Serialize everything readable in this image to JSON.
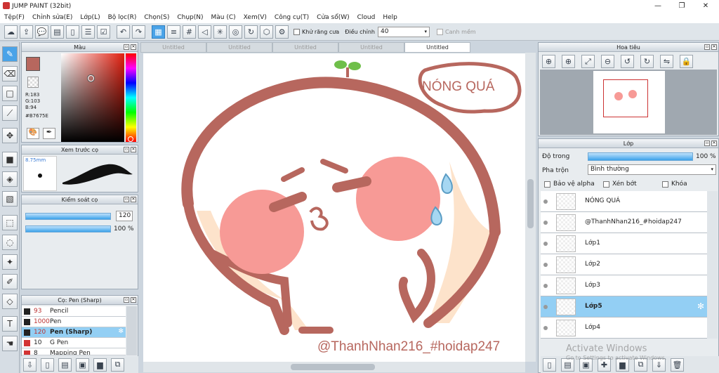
{
  "window": {
    "title": "JUMP PAINT (32bit)",
    "min": "—",
    "max": "❐",
    "close": "✕"
  },
  "menu": [
    "Tệp(F)",
    "Chỉnh sửa(E)",
    "Lớp(L)",
    "Bộ lọc(R)",
    "Chọn(S)",
    "Chụp(N)",
    "Màu (C)",
    "Xem(V)",
    "Công cụ(T)",
    "Cửa sổ(W)",
    "Cloud",
    "Help"
  ],
  "toolbar": {
    "antialias_label": "Khử răng cưa",
    "adjust_label": "Điều chỉnh",
    "adjust_value": "40",
    "edge_label": "Canh mềm"
  },
  "color_panel": {
    "title": "Màu",
    "r": "R:183",
    "g": "G:103",
    "b": "B:94",
    "hex": "#B7675E",
    "main_color": "#B7675E"
  },
  "preview_panel": {
    "title": "Xem trước cọ",
    "size": "8.75mm"
  },
  "brush_control": {
    "title": "Kiểm soát cọ",
    "size": "120",
    "opacity": "100 %"
  },
  "brush_list": {
    "title": "Cọ: Pen (Sharp)",
    "items": [
      {
        "size": "93",
        "name": "Pencil",
        "color": "#222222"
      },
      {
        "size": "1000",
        "name": "Pen",
        "color": "#222222"
      },
      {
        "size": "120",
        "name": "Pen (Sharp)",
        "color": "#222222"
      },
      {
        "size": "10",
        "name": "G Pen",
        "color": "#d33333"
      },
      {
        "size": "8",
        "name": "Mapping Pen",
        "color": "#d33333"
      }
    ]
  },
  "tabs": [
    "Untitled",
    "Untitled",
    "Untitled",
    "Untitled",
    "Untitled"
  ],
  "canvas": {
    "bubble_text": "NÓNG QUÁ",
    "watermark": "@ThanhNhan216_#hoidap247"
  },
  "navigator": {
    "title": "Hoa tiêu"
  },
  "layers_panel": {
    "title": "Lớp",
    "opacity_label": "Độ trong",
    "opacity_value": "100 %",
    "blend_label": "Pha trộn",
    "blend_value": "Bình thường",
    "alpha_label": "Bảo vệ alpha",
    "clip_label": "Xén bớt",
    "lock_label": "Khóa"
  },
  "layers": [
    "NÓNG QUÁ",
    "@ThanhNhan216_#hoidap247",
    "Lớp1",
    "Lớp2",
    "Lớp3",
    "Lớp5",
    "Lớp4"
  ],
  "activate": {
    "line1": "Activate Windows",
    "line2": "Go to Settings to activate Windows."
  }
}
